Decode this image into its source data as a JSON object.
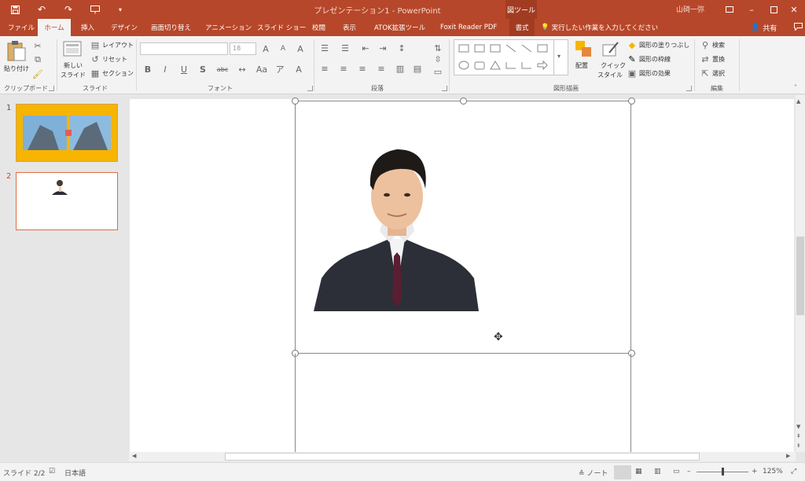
{
  "window": {
    "title": "プレゼンテーション1 - PowerPoint",
    "context_tab": "図ツール",
    "user": "山碕一弥",
    "qat": [
      "save-icon",
      "undo-icon",
      "redo-icon",
      "start-slideshow-icon",
      "customize-icon"
    ]
  },
  "tabs": {
    "file": "ファイル",
    "home": "ホーム",
    "insert": "挿入",
    "design": "デザイン",
    "transitions": "画面切り替え",
    "animations": "アニメーション",
    "slideshow": "スライド ショー",
    "review": "校閲",
    "view": "表示",
    "atok": "ATOK拡張ツール",
    "foxit": "Foxit Reader PDF",
    "format": "書式"
  },
  "tell_me": "実行したい作業を入力してください",
  "share": "共有",
  "ribbon": {
    "clipboard": {
      "label": "クリップボード",
      "paste": "貼り付け"
    },
    "slides": {
      "label": "スライド",
      "new_slide_1": "新しい",
      "new_slide_2": "スライド",
      "layout": "レイアウト",
      "reset": "リセット",
      "section": "セクション"
    },
    "font": {
      "label": "フォント",
      "font_name": "",
      "font_size": "18"
    },
    "paragraph": {
      "label": "段落"
    },
    "drawing": {
      "label": "図形描画",
      "arrange": "配置",
      "quick_1": "クイック",
      "quick_2": "スタイル",
      "fill": "図形の塗りつぶし",
      "outline": "図形の枠線",
      "effects": "図形の効果"
    },
    "editing": {
      "label": "編集",
      "find": "検索",
      "replace": "置換",
      "select": "選択"
    }
  },
  "thumbnails": {
    "slide1": "1",
    "slide2": "2"
  },
  "status": {
    "slide_info": "スライド 2/2",
    "language": "日本語",
    "notes": "ノート",
    "zoom": "125%"
  },
  "colors": {
    "accent": "#b7472a",
    "ribbon_bg": "#f3f3f3"
  }
}
